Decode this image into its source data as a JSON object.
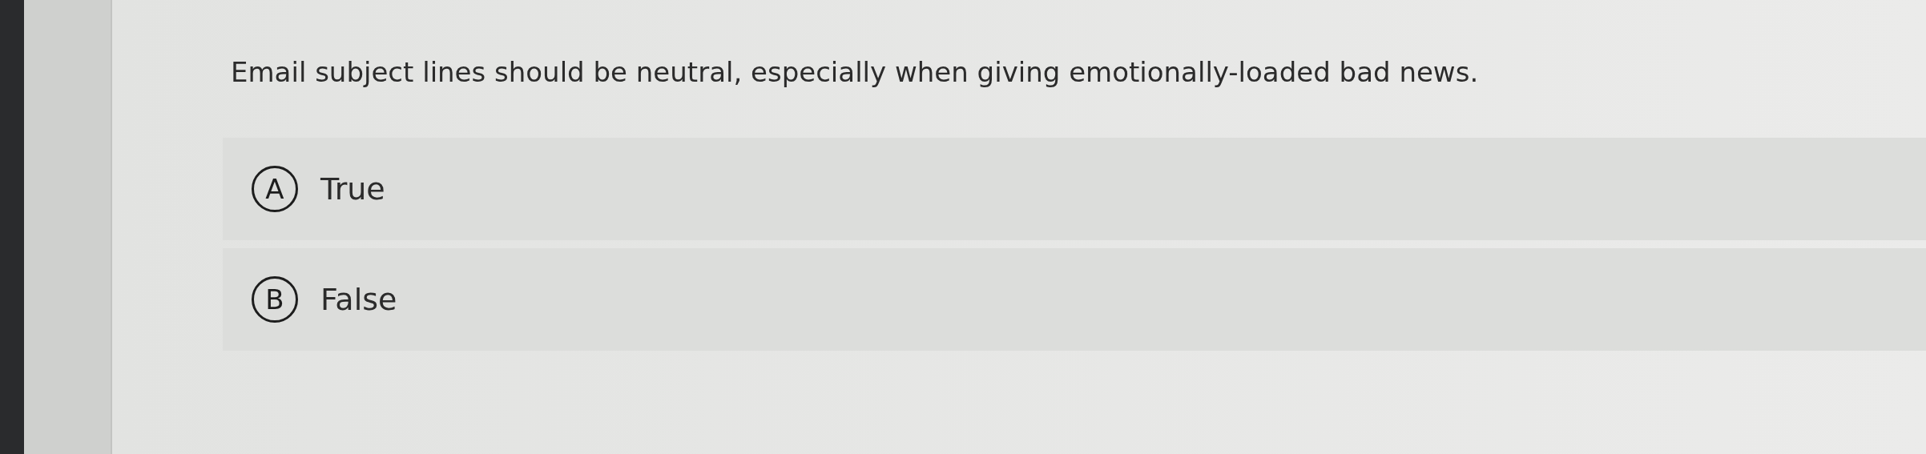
{
  "question": {
    "text": "Email subject lines should be neutral, especially when giving emotionally-loaded bad news."
  },
  "options": [
    {
      "letter": "A",
      "label": "True",
      "selected": false
    },
    {
      "letter": "B",
      "label": "False",
      "selected": false
    }
  ]
}
